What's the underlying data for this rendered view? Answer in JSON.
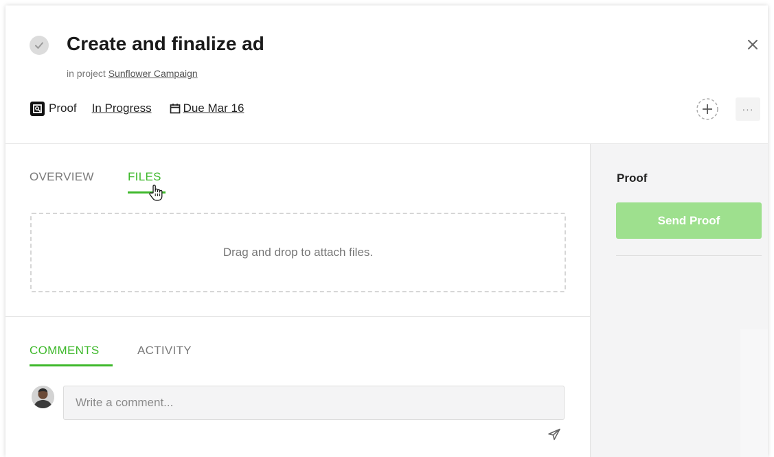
{
  "task": {
    "title": "Create and finalize ad",
    "project_prefix": "in project",
    "project_name": "Sunflower Campaign",
    "type_label": "Proof",
    "status": "In Progress",
    "due": "Due Mar 16"
  },
  "header": {
    "more_label": "···"
  },
  "tabs": {
    "overview": "OVERVIEW",
    "files": "FILES",
    "active": "files"
  },
  "files": {
    "dropzone_text": "Drag and drop to attach files."
  },
  "discussion": {
    "comments_tab": "COMMENTS",
    "activity_tab": "ACTIVITY",
    "active": "comments",
    "comment_placeholder": "Write a comment..."
  },
  "sidebar": {
    "proof_heading": "Proof",
    "send_proof_label": "Send Proof"
  },
  "colors": {
    "accent": "#3db82a",
    "send_proof_bg": "#9ee08e",
    "panel_bg": "#f4f4f5"
  },
  "icons": [
    "check-icon",
    "close-icon",
    "proof-icon",
    "calendar-icon",
    "add-member-icon",
    "more-icon",
    "hand-cursor-icon",
    "send-icon"
  ]
}
